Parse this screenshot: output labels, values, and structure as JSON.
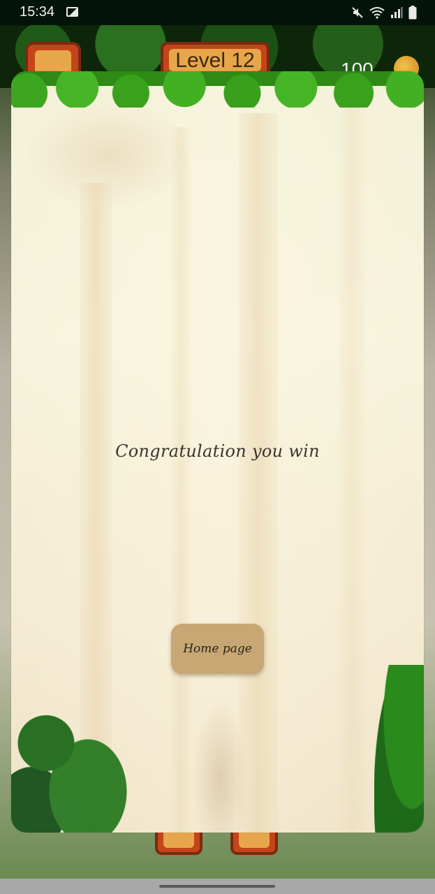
{
  "status_bar": {
    "time": "15:34",
    "icons": [
      "gallery-icon",
      "mute-icon",
      "wifi-icon",
      "signal-icon",
      "battery-icon"
    ]
  },
  "hud": {
    "level_label": "Level 12",
    "coins": "100",
    "icons": [
      "back-arrow-icon",
      "coin-icon",
      "pencil-icon",
      "eraser-icon"
    ]
  },
  "dialog": {
    "message": "Congratulation you win",
    "home_button_label": "Home page"
  },
  "colors": {
    "dialog_bg": "#f3f1d8",
    "home_button": "#c7a774",
    "canopy_green": "#3da620",
    "hud_orange": "#c4451a"
  }
}
